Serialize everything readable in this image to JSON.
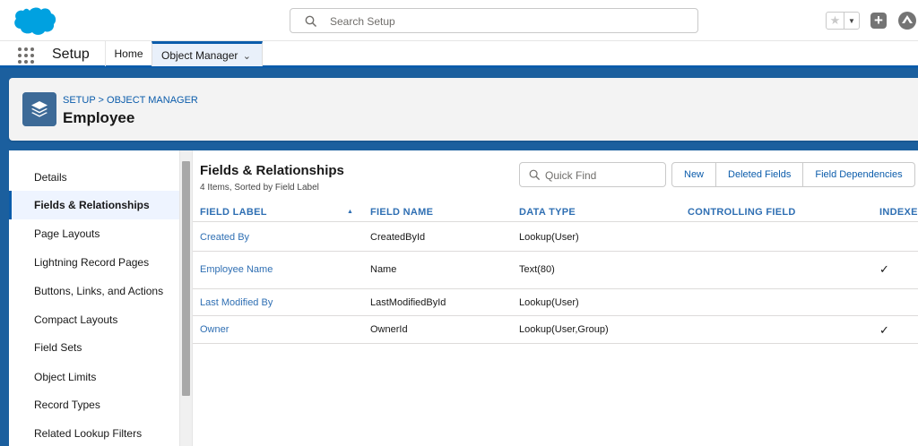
{
  "global_header": {
    "search_placeholder": "Search Setup"
  },
  "context_bar": {
    "app_name": "Setup",
    "tabs": [
      {
        "label": "Home"
      },
      {
        "label": "Object Manager"
      }
    ]
  },
  "object_header": {
    "breadcrumb": "SETUP > OBJECT MANAGER",
    "title": "Employee"
  },
  "sidebar": {
    "items": [
      {
        "label": "Details"
      },
      {
        "label": "Fields & Relationships"
      },
      {
        "label": "Page Layouts"
      },
      {
        "label": "Lightning Record Pages"
      },
      {
        "label": "Buttons, Links, and Actions"
      },
      {
        "label": "Compact Layouts"
      },
      {
        "label": "Field Sets"
      },
      {
        "label": "Object Limits"
      },
      {
        "label": "Record Types"
      },
      {
        "label": "Related Lookup Filters"
      }
    ],
    "active_index": 1
  },
  "section": {
    "title": "Fields & Relationships",
    "subtitle": "4 Items, Sorted by Field Label",
    "quickfind_placeholder": "Quick Find",
    "buttons": [
      "New",
      "Deleted Fields",
      "Field Dependencies"
    ]
  },
  "table": {
    "columns": [
      "FIELD LABEL",
      "FIELD NAME",
      "DATA TYPE",
      "CONTROLLING FIELD",
      "INDEXED"
    ],
    "rows": [
      {
        "label": "Created By",
        "name": "CreatedById",
        "type": "Lookup(User)",
        "controlling": "",
        "indexed": false
      },
      {
        "label": "Employee Name",
        "name": "Name",
        "type": "Text(80)",
        "controlling": "",
        "indexed": true
      },
      {
        "label": "Last Modified By",
        "name": "LastModifiedById",
        "type": "Lookup(User)",
        "controlling": "",
        "indexed": false
      },
      {
        "label": "Owner",
        "name": "OwnerId",
        "type": "Lookup(User,Group)",
        "controlling": "",
        "indexed": true
      }
    ]
  },
  "colors": {
    "brand_blue": "#0b5cab",
    "band_blue": "#1b5f9e",
    "link_blue": "#2f6fb3",
    "salesforce_cloud": "#00a1e0"
  }
}
